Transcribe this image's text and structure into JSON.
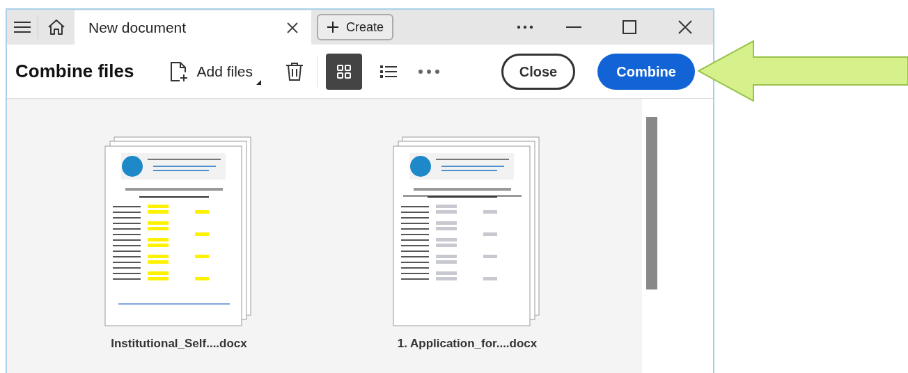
{
  "window": {
    "tab_title": "New document",
    "create_button": "Create"
  },
  "toolbar": {
    "title": "Combine files",
    "add_files": "Add files",
    "views": [
      {
        "kind": "grid",
        "selected": true
      },
      {
        "kind": "list",
        "selected": false
      }
    ],
    "close_button": "Close",
    "combine_button": "Combine"
  },
  "files": [
    {
      "name": "Institutional_Self....docx",
      "kind": "report"
    },
    {
      "name": "1. Application_for....docx",
      "kind": "application"
    }
  ]
}
